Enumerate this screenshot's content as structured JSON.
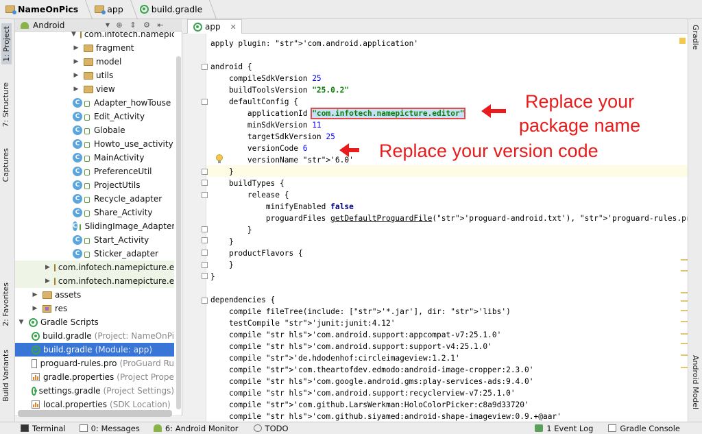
{
  "breadcrumb": [
    "NameOnPics",
    "app",
    "build.gradle"
  ],
  "left_tabs": {
    "project": "1: Project",
    "structure": "7: Structure",
    "captures": "Captures",
    "favorites": "2: Favorites",
    "build_variants": "Build Variants"
  },
  "right_tabs": {
    "gradle": "Gradle",
    "android_model": "Android Model"
  },
  "project_view": {
    "selector": "Android"
  },
  "tree": [
    {
      "label": "com.infotech.namepicture.e",
      "extra": "",
      "kind": "folder"
    },
    {
      "label": "fragment",
      "extra": "",
      "kind": "folder"
    },
    {
      "label": "model",
      "extra": "",
      "kind": "folder"
    },
    {
      "label": "utils",
      "extra": "",
      "kind": "folder"
    },
    {
      "label": "view",
      "extra": "",
      "kind": "folder"
    },
    {
      "label": "Adapter_howTouse",
      "extra": "",
      "kind": "class"
    },
    {
      "label": "Edit_Activity",
      "extra": "",
      "kind": "class"
    },
    {
      "label": "Globale",
      "extra": "",
      "kind": "class"
    },
    {
      "label": "Howto_use_activity",
      "extra": "",
      "kind": "class"
    },
    {
      "label": "MainActivity",
      "extra": "",
      "kind": "class"
    },
    {
      "label": "PreferenceUtil",
      "extra": "",
      "kind": "class"
    },
    {
      "label": "ProjectUtils",
      "extra": "",
      "kind": "class"
    },
    {
      "label": "Recycle_adapter",
      "extra": "",
      "kind": "class"
    },
    {
      "label": "Share_Activity",
      "extra": "",
      "kind": "class"
    },
    {
      "label": "SlidingImage_Adapter",
      "extra": "",
      "kind": "class"
    },
    {
      "label": "Start_Activity",
      "extra": "",
      "kind": "class"
    },
    {
      "label": "Sticker_adapter",
      "extra": "",
      "kind": "class"
    },
    {
      "label": "com.infotech.namepicture.e",
      "extra": "",
      "kind": "folder"
    },
    {
      "label": "com.infotech.namepicture.e",
      "extra": "",
      "kind": "folder"
    },
    {
      "label": "assets",
      "extra": "",
      "kind": "folder"
    },
    {
      "label": "res",
      "extra": "",
      "kind": "res"
    },
    {
      "label": "Gradle Scripts",
      "extra": "",
      "kind": "gradle"
    },
    {
      "label": "build.gradle",
      "extra": "(Project: NameOnPi",
      "kind": "gradle"
    },
    {
      "label": "build.gradle",
      "extra": "(Module: app)",
      "kind": "gradle"
    },
    {
      "label": "proguard-rules.pro",
      "extra": "(ProGuard Ru",
      "kind": "file"
    },
    {
      "label": "gradle.properties",
      "extra": "(Project Proper",
      "kind": "prop"
    },
    {
      "label": "settings.gradle",
      "extra": "(Project Settings)",
      "kind": "gradle"
    },
    {
      "label": "local.properties",
      "extra": "(SDK Location)",
      "kind": "prop"
    }
  ],
  "editor": {
    "tab": "app",
    "lines": [
      "apply plugin: 'com.android.application'",
      "",
      "android {",
      "    compileSdkVersion 25",
      "    buildToolsVersion \"25.0.2\"",
      "    defaultConfig {",
      "        applicationId \"com.infotech.namepicture.editor\"",
      "        minSdkVersion 11",
      "        targetSdkVersion 25",
      "        versionCode 6",
      "        versionName '6.0'",
      "    }",
      "    buildTypes {",
      "        release {",
      "            minifyEnabled false",
      "            proguardFiles getDefaultProguardFile('proguard-android.txt'), 'proguard-rules.pro'",
      "        }",
      "    }",
      "    productFlavors {",
      "    }",
      "}",
      "",
      "dependencies {",
      "    compile fileTree(include: ['*.jar'], dir: 'libs')",
      "    testCompile 'junit:junit:4.12'",
      "    compile 'com.android.support:appcompat-v7:25.1.0'",
      "    compile 'com.android.support:support-v4:25.1.0'",
      "    compile 'de.hdodenhof:circleimageview:1.2.1'",
      "    compile 'com.theartofdev.edmodo:android-image-cropper:2.3.0'",
      "    compile 'com.google.android.gms:play-services-ads:9.4.0'",
      "    compile 'com.android.support:recyclerview-v7:25.1.0'",
      "    compile 'com.github.LarsWerkman:HoloColorPicker:c8a9d33720'",
      "    compile 'com.github.siyamed:android-shape-imageview:0.9.+@aar'"
    ]
  },
  "annotations": {
    "package_line1": "Replace your",
    "package_line2": "package name",
    "version": "Replace your version code"
  },
  "bottom_bar": {
    "terminal": "Terminal",
    "messages": "0: Messages",
    "android_monitor": "6: Android Monitor",
    "todo": "TODO",
    "event_log": "1 Event Log",
    "gradle_console": "Gradle Console"
  },
  "colors": {
    "accent_red": "#e81c1c",
    "selection": "#3875d7",
    "string_green": "#088008"
  }
}
